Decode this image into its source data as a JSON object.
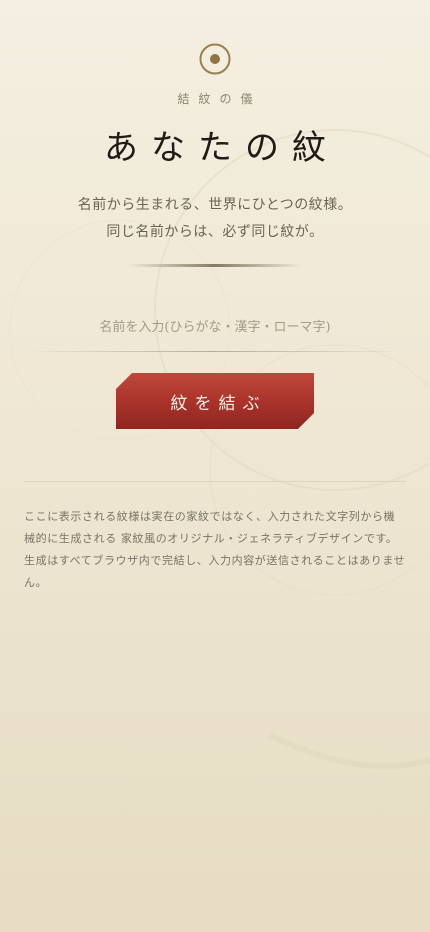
{
  "header": {
    "logo_icon": "concentric-circle-crest-icon",
    "eyebrow": "結紋の儀",
    "title": "あなたの紋",
    "subtitle_line1": "名前から生まれる、世界にひとつの紋様。",
    "subtitle_line2": "同じ名前からは、必ず同じ紋が。"
  },
  "form": {
    "name_placeholder": "名前を入力(ひらがな・漢字・ローマ字)",
    "name_value": "",
    "submit_label": "紋を結ぶ"
  },
  "footer": {
    "disclaimer": "ここに表示される紋様は実在の家紋ではなく、入力された文字列から機械的に生成される 家紋風のオリジナル・ジェネラティブデザインです。生成はすべてブラウザ内で完結し、入力内容が送信されることはありません。"
  },
  "colors": {
    "accent_red": "#a8322a",
    "gold": "#9a8050",
    "background": "#f1ebdb",
    "text_dark": "#1f1b17"
  }
}
